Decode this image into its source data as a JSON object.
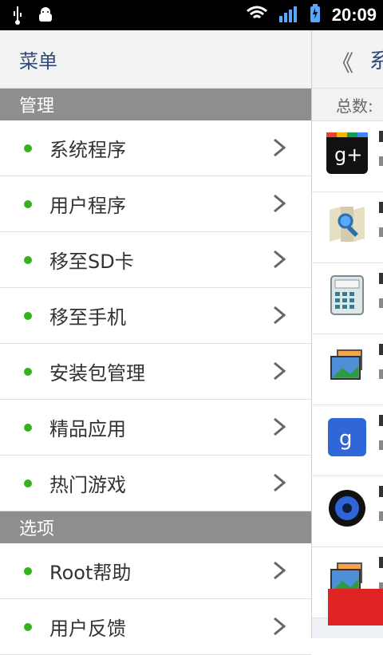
{
  "status_bar": {
    "time": "20:09",
    "icons": [
      "usb-icon",
      "android-debug-icon",
      "wifi-icon",
      "signal-icon",
      "battery-charging-icon"
    ]
  },
  "drawer": {
    "title": "菜单",
    "sections": [
      {
        "title": "管理",
        "items": [
          {
            "label": "系统程序"
          },
          {
            "label": "用户程序"
          },
          {
            "label": "移至SD卡"
          },
          {
            "label": "移至手机"
          },
          {
            "label": "安装包管理"
          },
          {
            "label": "精品应用"
          },
          {
            "label": "热门游戏"
          }
        ]
      },
      {
        "title": "选项",
        "items": [
          {
            "label": "Root帮助"
          },
          {
            "label": "用户反馈"
          }
        ]
      }
    ]
  },
  "right_panel": {
    "back_symbol": "《",
    "title_partial": "系",
    "total_label": "总数:",
    "apps": [
      {
        "icon": "google-plus-icon"
      },
      {
        "icon": "maps-icon"
      },
      {
        "icon": "calculator-icon"
      },
      {
        "icon": "gallery-icon"
      },
      {
        "icon": "google-search-icon"
      },
      {
        "icon": "speaker-icon"
      },
      {
        "icon": "gallery-icon"
      }
    ]
  },
  "colors": {
    "accent": "#34b11d",
    "title": "#2c4a7d",
    "section": "#8e8e8e",
    "danger": "#e02424"
  }
}
